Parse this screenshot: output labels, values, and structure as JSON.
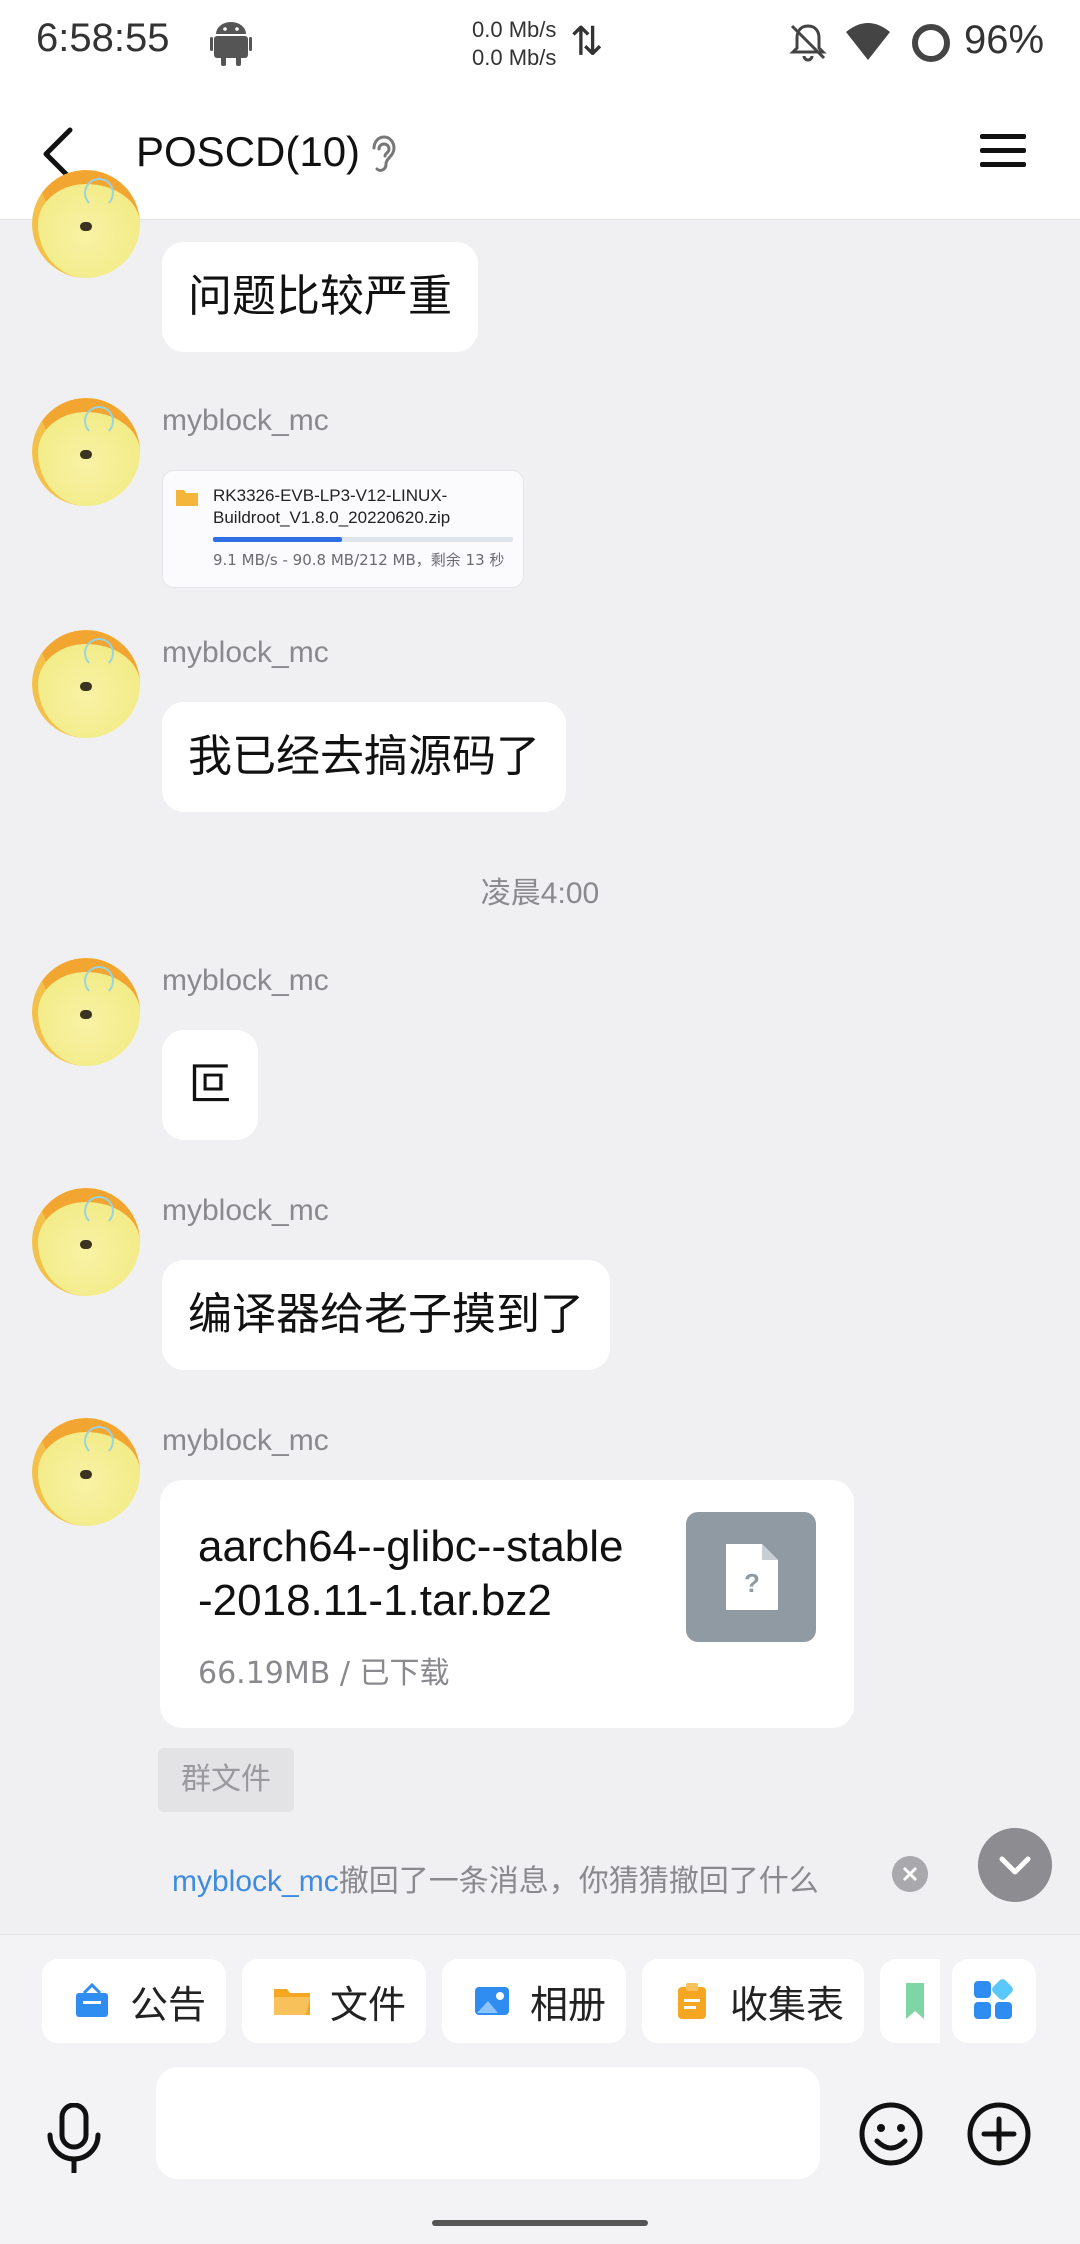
{
  "status_bar": {
    "time": "6:58:55",
    "net_up": "0.0 Mb/s",
    "net_down": "0.0 Mb/s",
    "battery": "96%"
  },
  "header": {
    "title": "POSCD(10)"
  },
  "messages": [
    {
      "text": "问题比较严重"
    },
    {
      "sender": "myblock_mc",
      "image_file": {
        "name_line1": "RK3326-EVB-LP3-V12-LINUX-",
        "name_line2": "Buildroot_V1.8.0_20220620.zip",
        "progress_info": "9.1 MB/s - 90.8 MB/212 MB，剩余 13 秒",
        "progress_fraction": 0.43
      }
    },
    {
      "sender": "myblock_mc",
      "text": "我已经去搞源码了"
    },
    {
      "timestamp": "凌晨4:00"
    },
    {
      "sender": "myblock_mc",
      "text": "叵"
    },
    {
      "sender": "myblock_mc",
      "text": "编译器给老子摸到了"
    },
    {
      "sender": "myblock_mc",
      "file": {
        "name_line1": "aarch64--glibc--stable",
        "name_line2": "-2018.11-1.tar.bz2",
        "meta": "66.19MB / 已下载",
        "tag": "群文件"
      }
    }
  ],
  "recall_notice": {
    "name": "myblock_mc",
    "text": "撤回了一条消息，你猜猜撤回了什么"
  },
  "quick_actions": [
    {
      "label": "公告",
      "color": "#2f8cf0"
    },
    {
      "label": "文件",
      "color": "#f5a623"
    },
    {
      "label": "相册",
      "color": "#2f8cf0"
    },
    {
      "label": "收集表",
      "color": "#f5a623"
    }
  ],
  "input": {
    "placeholder": ""
  }
}
